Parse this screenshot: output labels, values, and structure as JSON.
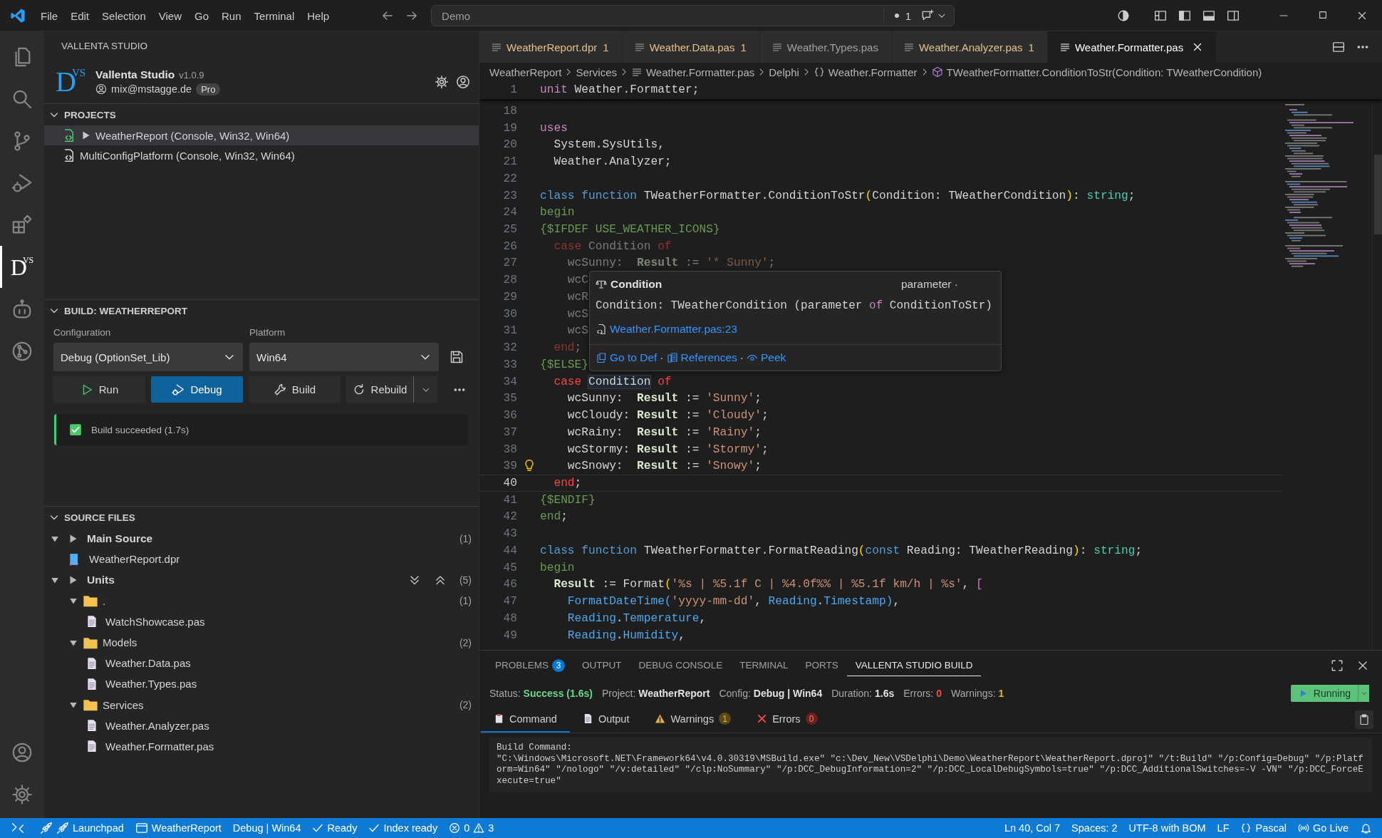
{
  "title_bar": {
    "menu": [
      "File",
      "Edit",
      "Selection",
      "View",
      "Go",
      "Run",
      "Terminal",
      "Help"
    ],
    "search": {
      "value": "Demo"
    },
    "changes": {
      "count": "1"
    }
  },
  "activity_bar": {
    "items": [
      {
        "kind": "explorer",
        "selected": false
      },
      {
        "kind": "search",
        "selected": false
      },
      {
        "kind": "source_control",
        "selected": false
      },
      {
        "kind": "run_debug",
        "selected": false
      },
      {
        "kind": "extensions",
        "selected": false
      },
      {
        "kind": "logo",
        "selected": true,
        "letter": "D",
        "superscript": "VS"
      },
      {
        "kind": "robot",
        "selected": false
      },
      {
        "kind": "git_graph",
        "selected": false
      }
    ],
    "bottom": [
      {
        "kind": "accounts"
      },
      {
        "kind": "settings"
      }
    ]
  },
  "sidebar": {
    "title": "VALLENTA STUDIO",
    "profile": {
      "letter": "D",
      "superscript": "VS",
      "name": "Vallenta Studio",
      "version": "v1.0.9",
      "email": "mix@mstagge.de",
      "plan": "Pro"
    },
    "projects": {
      "title": "PROJECTS",
      "expanded": true,
      "items": [
        {
          "label": "WeatherReport (Console, Win32, Win64)",
          "selected": true,
          "active": true
        },
        {
          "label": "MultiConfigPlatform (Console, Win32, Win64)",
          "selected": false,
          "active": false
        }
      ]
    },
    "build": {
      "title": "BUILD: WEATHERREPORT",
      "expanded": true,
      "configuration": {
        "label": "Configuration",
        "value": "Debug (OptionSet_Lib)"
      },
      "platform": {
        "label": "Platform",
        "value": "Win64"
      },
      "buttons": [
        {
          "kind": "run",
          "label": "Run",
          "primary": false
        },
        {
          "kind": "debug",
          "label": "Debug",
          "primary": true
        },
        {
          "kind": "build",
          "label": "Build",
          "primary": false
        },
        {
          "kind": "rebuild",
          "label": "Rebuild",
          "primary": false
        }
      ],
      "result": {
        "succeeded": true,
        "message": "Build succeeded (1.7s)"
      }
    },
    "source_files": {
      "title": "SOURCE FILES",
      "expanded": true,
      "groups": [
        {
          "label": "Main Source",
          "count": "(1)",
          "expanded": true,
          "children": [
            {
              "kind": "project",
              "label": "WeatherReport.dpr"
            }
          ]
        },
        {
          "label": "Units",
          "count": "(5)",
          "expanded": true,
          "children": [
            {
              "kind": "folder",
              "label": ".",
              "count": "(1)",
              "expanded": true,
              "children": [
                {
                  "kind": "file",
                  "label": "WatchShowcase.pas"
                }
              ]
            },
            {
              "kind": "folder",
              "label": "Models",
              "count": "(2)",
              "expanded": true,
              "children": [
                {
                  "kind": "file",
                  "label": "Weather.Data.pas"
                },
                {
                  "kind": "file",
                  "label": "Weather.Types.pas"
                }
              ]
            },
            {
              "kind": "folder",
              "label": "Services",
              "count": "(2)",
              "expanded": true,
              "children": [
                {
                  "kind": "file",
                  "label": "Weather.Analyzer.pas"
                },
                {
                  "kind": "file",
                  "label": "Weather.Formatter.pas"
                }
              ]
            }
          ]
        }
      ]
    }
  },
  "editor": {
    "tabs": [
      {
        "label": "WeatherReport.dpr",
        "problems": "1",
        "selected": false
      },
      {
        "label": "Weather.Data.pas",
        "problems": "1",
        "selected": false
      },
      {
        "label": "Weather.Types.pas",
        "selected": false
      },
      {
        "label": "Weather.Analyzer.pas",
        "problems": "1",
        "selected": false
      },
      {
        "label": "Weather.Formatter.pas",
        "selected": true
      }
    ],
    "breadcrumbs": [
      {
        "kind": "folder",
        "label": "WeatherReport"
      },
      {
        "kind": "folder",
        "label": "Services"
      },
      {
        "kind": "file",
        "label": "Weather.Formatter.pas"
      },
      {
        "kind": "language",
        "label": "Delphi"
      },
      {
        "kind": "namespace",
        "label": "Weather.Formatter"
      },
      {
        "kind": "method",
        "label": "TWeatherFormatter.ConditionToStr(Condition: TWeatherCondition)"
      }
    ],
    "sticky_line": {
      "number": "1",
      "tokens": [
        {
          "kind": "storage",
          "text": "unit"
        },
        {
          "kind": "plain",
          "text": " Weather.Formatter;"
        }
      ]
    },
    "lines": [
      {
        "number": "18",
        "current": false,
        "lightbulb": false
      },
      {
        "number": "19",
        "inactive": false,
        "current": false,
        "lightbulb": false,
        "tokens": [
          {
            "kind": "storage",
            "text": "uses"
          }
        ]
      },
      {
        "number": "20",
        "inactive": false,
        "current": false,
        "lightbulb": false,
        "tokens": [
          {
            "kind": "plain",
            "text": "  System.SysUtils,"
          }
        ]
      },
      {
        "number": "21",
        "inactive": false,
        "current": false,
        "lightbulb": false,
        "tokens": [
          {
            "kind": "plain",
            "text": "  Weather.Analyzer;"
          }
        ]
      },
      {
        "number": "22",
        "current": false,
        "lightbulb": false
      },
      {
        "number": "23",
        "inactive": false,
        "current": false,
        "lightbulb": false,
        "tokens": [
          {
            "kind": "keyword",
            "text": "class function"
          },
          {
            "kind": "plain",
            "text": " TWeatherFormatter.ConditionToStr"
          },
          {
            "kind": "paren",
            "text": "("
          },
          {
            "kind": "plain",
            "text": "Condition: TWeatherCondition"
          },
          {
            "kind": "paren",
            "text": ")"
          },
          {
            "kind": "plain",
            "text": ": "
          },
          {
            "kind": "type",
            "text": "string"
          },
          {
            "kind": "plain",
            "text": ";"
          }
        ]
      },
      {
        "number": "24",
        "inactive": false,
        "current": false,
        "lightbulb": false,
        "tokens": [
          {
            "kind": "begin",
            "text": "begin"
          }
        ]
      },
      {
        "number": "25",
        "inactive": false,
        "current": false,
        "lightbulb": false,
        "tokens": [
          {
            "kind": "directive",
            "text": "{$IFDEF USE_WEATHER_ICONS}"
          }
        ]
      },
      {
        "number": "26",
        "inactive": true,
        "current": false,
        "lightbulb": false,
        "tokens": [
          {
            "kind": "control",
            "text": "  case"
          },
          {
            "kind": "plain",
            "text": " Condition "
          },
          {
            "kind": "control",
            "text": "of"
          }
        ]
      },
      {
        "number": "27",
        "inactive": true,
        "current": false,
        "lightbulb": false,
        "tokens": [
          {
            "kind": "plain",
            "text": "    wcSunny:  "
          },
          {
            "kind": "result",
            "text": "Result"
          },
          {
            "kind": "plain",
            "text": " := "
          },
          {
            "kind": "string",
            "text": "'* Sunny'"
          },
          {
            "kind": "plain",
            "text": ";"
          }
        ]
      },
      {
        "number": "28",
        "inactive": true,
        "current": false,
        "lightbulb": false,
        "tokens": [
          {
            "kind": "plain",
            "text": "    wcC"
          }
        ]
      },
      {
        "number": "29",
        "inactive": true,
        "current": false,
        "lightbulb": false,
        "tokens": [
          {
            "kind": "plain",
            "text": "    wcR"
          }
        ]
      },
      {
        "number": "30",
        "inactive": true,
        "current": false,
        "lightbulb": false,
        "tokens": [
          {
            "kind": "plain",
            "text": "    wcS"
          }
        ]
      },
      {
        "number": "31",
        "inactive": true,
        "current": false,
        "lightbulb": false,
        "tokens": [
          {
            "kind": "plain",
            "text": "    wcS"
          }
        ]
      },
      {
        "number": "32",
        "inactive": true,
        "current": false,
        "lightbulb": false,
        "tokens": [
          {
            "kind": "control",
            "text": "  end"
          },
          {
            "kind": "plain",
            "text": ";"
          }
        ]
      },
      {
        "number": "33",
        "inactive": false,
        "current": false,
        "lightbulb": false,
        "tokens": [
          {
            "kind": "directive",
            "text": "{$ELSE}"
          }
        ]
      },
      {
        "number": "34",
        "inactive": false,
        "current": false,
        "lightbulb": false,
        "tokens": [
          {
            "kind": "control",
            "text": "  case "
          },
          {
            "kind": "match",
            "text": "Condition"
          },
          {
            "kind": "control",
            "text": " of"
          }
        ]
      },
      {
        "number": "35",
        "inactive": false,
        "current": false,
        "lightbulb": false,
        "tokens": [
          {
            "kind": "plain",
            "text": "    wcSunny:  "
          },
          {
            "kind": "result",
            "text": "Result"
          },
          {
            "kind": "plain",
            "text": " := "
          },
          {
            "kind": "string",
            "text": "'Sunny'"
          },
          {
            "kind": "plain",
            "text": ";"
          }
        ]
      },
      {
        "number": "36",
        "inactive": false,
        "current": false,
        "lightbulb": false,
        "tokens": [
          {
            "kind": "plain",
            "text": "    wcCloudy: "
          },
          {
            "kind": "result",
            "text": "Result"
          },
          {
            "kind": "plain",
            "text": " := "
          },
          {
            "kind": "string",
            "text": "'Cloudy'"
          },
          {
            "kind": "plain",
            "text": ";"
          }
        ]
      },
      {
        "number": "37",
        "inactive": false,
        "current": false,
        "lightbulb": false,
        "tokens": [
          {
            "kind": "plain",
            "text": "    wcRainy:  "
          },
          {
            "kind": "result",
            "text": "Result"
          },
          {
            "kind": "plain",
            "text": " := "
          },
          {
            "kind": "string",
            "text": "'Rainy'"
          },
          {
            "kind": "plain",
            "text": ";"
          }
        ]
      },
      {
        "number": "38",
        "inactive": false,
        "current": false,
        "lightbulb": false,
        "tokens": [
          {
            "kind": "plain",
            "text": "    wcStormy: "
          },
          {
            "kind": "result",
            "text": "Result"
          },
          {
            "kind": "plain",
            "text": " := "
          },
          {
            "kind": "string",
            "text": "'Stormy'"
          },
          {
            "kind": "plain",
            "text": ";"
          }
        ]
      },
      {
        "number": "39",
        "inactive": false,
        "current": false,
        "lightbulb": true,
        "tokens": [
          {
            "kind": "plain",
            "text": "    wcSnowy:  "
          },
          {
            "kind": "result",
            "text": "Result"
          },
          {
            "kind": "plain",
            "text": " := "
          },
          {
            "kind": "string",
            "text": "'Snowy'"
          },
          {
            "kind": "plain",
            "text": ";"
          }
        ]
      },
      {
        "number": "40",
        "inactive": false,
        "current": true,
        "lightbulb": false,
        "tokens": [
          {
            "kind": "control",
            "text": "  end"
          },
          {
            "kind": "plain",
            "text": ";"
          }
        ]
      },
      {
        "number": "41",
        "inactive": false,
        "current": false,
        "lightbulb": false,
        "tokens": [
          {
            "kind": "directive",
            "text": "{$ENDIF}"
          }
        ]
      },
      {
        "number": "42",
        "inactive": false,
        "current": false,
        "lightbulb": false,
        "tokens": [
          {
            "kind": "begin",
            "text": "end"
          },
          {
            "kind": "plain",
            "text": ";"
          }
        ]
      },
      {
        "number": "43",
        "current": false,
        "lightbulb": false
      },
      {
        "number": "44",
        "inactive": false,
        "current": false,
        "lightbulb": false,
        "tokens": [
          {
            "kind": "keyword",
            "text": "class function"
          },
          {
            "kind": "plain",
            "text": " TWeatherFormatter.FormatReading"
          },
          {
            "kind": "paren",
            "text": "("
          },
          {
            "kind": "keyword",
            "text": "const"
          },
          {
            "kind": "plain",
            "text": " Reading: TWeatherReading"
          },
          {
            "kind": "paren",
            "text": ")"
          },
          {
            "kind": "plain",
            "text": ": "
          },
          {
            "kind": "type",
            "text": "string"
          },
          {
            "kind": "plain",
            "text": ";"
          }
        ]
      },
      {
        "number": "45",
        "inactive": false,
        "current": false,
        "lightbulb": false,
        "tokens": [
          {
            "kind": "begin",
            "text": "begin"
          }
        ]
      },
      {
        "number": "46",
        "inactive": false,
        "current": false,
        "lightbulb": false,
        "tokens": [
          {
            "kind": "result",
            "text": "  Result"
          },
          {
            "kind": "plain",
            "text": " := Format"
          },
          {
            "kind": "paren",
            "text": "("
          },
          {
            "kind": "string",
            "text": "'%s | %5.1f C | %4.0f%% | %5.1f km/h | %s'"
          },
          {
            "kind": "plain",
            "text": ", "
          },
          {
            "kind": "bracket",
            "text": "["
          }
        ]
      },
      {
        "number": "47",
        "inactive": false,
        "current": false,
        "lightbulb": false,
        "tokens": [
          {
            "kind": "member",
            "text": "    FormatDateTime("
          },
          {
            "kind": "string",
            "text": "'yyyy-mm-dd'"
          },
          {
            "kind": "plain",
            "text": ", "
          },
          {
            "kind": "member",
            "text": "Reading"
          },
          {
            "kind": "plain",
            "text": "."
          },
          {
            "kind": "member",
            "text": "Timestamp)"
          },
          {
            "kind": "plain",
            "text": ","
          }
        ]
      },
      {
        "number": "48",
        "inactive": false,
        "current": false,
        "lightbulb": false,
        "tokens": [
          {
            "kind": "member",
            "text": "    Reading"
          },
          {
            "kind": "plain",
            "text": "."
          },
          {
            "kind": "member",
            "text": "Temperature"
          },
          {
            "kind": "plain",
            "text": ","
          }
        ]
      },
      {
        "number": "49",
        "inactive": false,
        "current": false,
        "lightbulb": false,
        "tokens": [
          {
            "kind": "member",
            "text": "    Reading"
          },
          {
            "kind": "plain",
            "text": "."
          },
          {
            "kind": "member",
            "text": "Humidity"
          },
          {
            "kind": "plain",
            "text": ","
          }
        ]
      }
    ],
    "hover": {
      "name": "Condition",
      "category": "parameter ·",
      "signature": [
        {
          "kind": "plain",
          "text": "Condition: TWeatherCondition (parameter "
        },
        {
          "kind": "storage",
          "text": "of"
        },
        {
          "kind": "plain",
          "text": " ConditionToStr)"
        }
      ],
      "location": "Weather.Formatter.pas:23",
      "actions": [
        {
          "kind": "definition",
          "label": "Go to Def",
          "separator": "·"
        },
        {
          "kind": "references",
          "label": "References",
          "separator": "·"
        },
        {
          "kind": "peek",
          "label": "Peek"
        }
      ]
    }
  },
  "panel": {
    "tabs": [
      {
        "label": "PROBLEMS",
        "badge": "3",
        "selected": false
      },
      {
        "label": "OUTPUT",
        "selected": false
      },
      {
        "label": "DEBUG CONSOLE",
        "selected": false
      },
      {
        "label": "TERMINAL",
        "selected": false
      },
      {
        "label": "PORTS",
        "selected": false
      },
      {
        "label": "VALLENTA STUDIO BUILD",
        "selected": true
      }
    ],
    "summary": [
      {
        "label": "Status:",
        "value": "Success (1.6s)",
        "kind": "success"
      },
      {
        "label": "Project:",
        "value": "WeatherReport",
        "kind": "strong"
      },
      {
        "label": "Config:",
        "value": "Debug | Win64",
        "kind": "strong"
      },
      {
        "label": "Duration:",
        "value": "1.6s",
        "kind": "strong"
      },
      {
        "label": "Errors:",
        "value": "0",
        "kind": "error"
      },
      {
        "label": "Warnings:",
        "value": "1",
        "kind": "warning"
      }
    ],
    "run_state": {
      "label": "Running"
    },
    "subtabs": [
      {
        "kind": "command",
        "label": "Command",
        "selected": true
      },
      {
        "kind": "output",
        "label": "Output",
        "selected": false
      },
      {
        "kind": "warnings",
        "label": "Warnings",
        "badge": "1",
        "selected": false
      },
      {
        "kind": "errors",
        "label": "Errors",
        "badge": "0",
        "selected": false
      }
    ],
    "output": {
      "heading": "Build Command:",
      "command": "\"C:\\Windows\\Microsoft.NET\\Framework64\\v4.0.30319\\MSBuild.exe\" \"c:\\Dev_New\\VSDelphi\\Demo\\WeatherReport\\WeatherReport.dproj\" \"/t:Build\" \"/p:Config=Debug\" \"/p:Platform=Win64\" \"/nologo\" \"/v:detailed\" \"/clp:NoSummary\" \"/p:DCC_DebugInformation=2\" \"/p:DCC_LocalDebugSymbols=true\" \"/p:DCC_AdditionalSwitches=-V -VN\" \"/p:DCC_ForceExecute=true\""
    }
  },
  "status_bar": {
    "left": [
      {
        "kind": "remote"
      },
      {
        "kind": "launchpad",
        "label": "Launchpad"
      },
      {
        "kind": "project",
        "label": "WeatherReport"
      },
      {
        "kind": "text",
        "label": "Debug | Win64"
      },
      {
        "kind": "check",
        "label": "Ready"
      },
      {
        "kind": "check",
        "label": "Index ready"
      },
      {
        "kind": "problems",
        "errors": "0",
        "warnings": "3"
      }
    ],
    "right": [
      {
        "kind": "text",
        "label": "Ln 40, Col 7"
      },
      {
        "kind": "text",
        "label": "Spaces: 2"
      },
      {
        "kind": "text",
        "label": "UTF-8 with BOM"
      },
      {
        "kind": "text",
        "label": "LF"
      },
      {
        "kind": "language",
        "label": "Pascal"
      },
      {
        "kind": "live",
        "label": "Go Live"
      },
      {
        "kind": "bell"
      }
    ]
  }
}
